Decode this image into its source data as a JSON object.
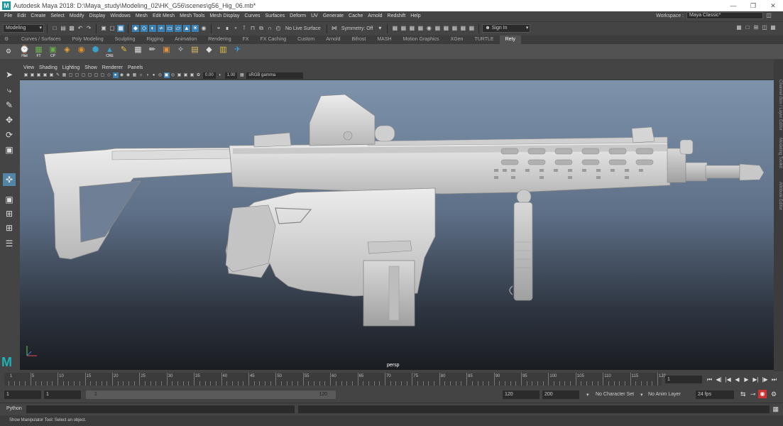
{
  "window": {
    "title": "Autodesk Maya 2018: D:\\Maya_study\\Modeling_02\\HK_G56\\scenes\\g56_Hig_06.mb*",
    "logo": "M",
    "min_icon": "minimize-icon",
    "max_icon": "restore-icon",
    "close_icon": "close-icon"
  },
  "menu": {
    "items": [
      "File",
      "Edit",
      "Create",
      "Select",
      "Modify",
      "Display",
      "Windows",
      "Mesh",
      "Edit Mesh",
      "Mesh Tools",
      "Mesh Display",
      "Curves",
      "Surfaces",
      "Deform",
      "UV",
      "Generate",
      "Cache",
      "Arnold",
      "Redshift",
      "Help"
    ]
  },
  "workspace": {
    "label": "Workspace :",
    "value": "Maya Classic*"
  },
  "statusline": {
    "menuset": "Modeling",
    "live_surface": "No Live Surface",
    "symmetry": "Symmetry: Off",
    "sign_in": "Sign In"
  },
  "shelf": {
    "tabs": [
      "Curves / Surfaces",
      "Poly Modeling",
      "Sculpting",
      "Rigging",
      "Animation",
      "Rendering",
      "FX",
      "FX Caching",
      "Custom",
      "Arnold",
      "Bifrost",
      "MASH",
      "Motion Graphics",
      "XGen",
      "TURTLE",
      "Rety"
    ],
    "active_tab": "Rety",
    "buttons": [
      {
        "icon": "hist-icon",
        "label": "Hist"
      },
      {
        "icon": "ft-icon",
        "label": "FT"
      },
      {
        "icon": "cp-icon",
        "label": "CP"
      },
      {
        "icon": "box-icon",
        "label": ""
      },
      {
        "icon": "sphere-icon",
        "label": ""
      },
      {
        "icon": "cube-icon",
        "label": ""
      },
      {
        "icon": "cre-icon",
        "label": "CRE"
      },
      {
        "icon": "brush-icon",
        "label": ""
      },
      {
        "icon": "grid-icon",
        "label": ""
      },
      {
        "icon": "pen-icon",
        "label": ""
      },
      {
        "icon": "package-icon",
        "label": ""
      },
      {
        "icon": "wand-icon",
        "label": ""
      },
      {
        "icon": "layers-icon",
        "label": ""
      },
      {
        "icon": "tag-icon",
        "label": ""
      },
      {
        "icon": "stack-icon",
        "label": ""
      },
      {
        "icon": "plane-icon",
        "label": ""
      }
    ]
  },
  "panel": {
    "menus": [
      "View",
      "Shading",
      "Lighting",
      "Show",
      "Renderer",
      "Panels"
    ],
    "exposure": "0.00",
    "gamma": "1.00",
    "color_space": "sRGB gamma",
    "camera": "persp"
  },
  "rightbar": {
    "tabs": [
      "Channel Box / Layer Editor",
      "Modeling Toolkit",
      "Attribute Editor"
    ]
  },
  "timeslider": {
    "ticks": [
      1,
      5,
      10,
      15,
      20,
      25,
      30,
      35,
      40,
      45,
      50,
      55,
      60,
      65,
      70,
      75,
      80,
      85,
      90,
      95,
      100,
      105,
      110,
      115,
      120
    ],
    "current_frame": "1"
  },
  "range": {
    "start": "1",
    "playback_start": "1",
    "slider_start": "1",
    "slider_end": "120",
    "playback_end": "120",
    "end": "200",
    "character_set": "No Character Set",
    "anim_layer": "No Anim Layer",
    "fps": "24 fps"
  },
  "command": {
    "label": "Python"
  },
  "help": {
    "text": "Show Manipulator Tool: Select an object."
  }
}
